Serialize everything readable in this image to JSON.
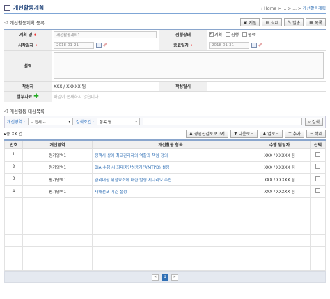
{
  "header": {
    "title": "개선활동계획",
    "breadcrumb": "› Home > ... > ... > ",
    "breadcrumb_current": "개선활동계획"
  },
  "register": {
    "title": "개선활동계획 등록",
    "buttons": [
      "저장",
      "삭제",
      "발송",
      "목록"
    ]
  },
  "form": {
    "plan_name_label": "계획 명",
    "plan_name_value": "개선활동계획1",
    "status_label": "진행상태",
    "status_options": [
      "계획",
      "진행",
      "종료"
    ],
    "start_label": "시작일자",
    "start_value": "2018-01-21",
    "end_label": "종료일자",
    "end_value": "2018-01-31",
    "desc_label": "설명",
    "desc_value": "-",
    "author_label": "작성자",
    "author_value": "XXX / XXXXX 팀",
    "date_label": "작성일시",
    "date_value": "-",
    "attach_label": "첨부자료",
    "attach_value": "파일이 존재하지 않습니다."
  },
  "targets": {
    "title": "개선활동 대상목록",
    "filter1_label": "개선영역 :",
    "filter1_value": "-- 전체 --",
    "filter2_label": "검색조건 :",
    "filter2_value": "항목 명",
    "search_button": "검색",
    "count": "총 XX 건",
    "buttons": [
      "경영진검토보고서",
      "다운로드",
      "업로드",
      "추가",
      "삭제"
    ]
  },
  "table": {
    "headers": [
      "번호",
      "개선영역",
      "개선활동 항목",
      "수행 담당자",
      "선택"
    ],
    "rows": [
      [
        "1",
        "평가영역1",
        "정책서 상에 최고관리자의 역할과 책임 정의",
        "XXX / XXXXX 팀"
      ],
      [
        "2",
        "평가영역1",
        "BIA 수행 시 최대중단허용기간(MTPD) 설정",
        "XXX / XXXXX 팀"
      ],
      [
        "3",
        "평가영역1",
        "관리대상 위험요소에 대한 발생 시나리오 수립",
        "XXX / XXXXX 팀"
      ],
      [
        "4",
        "평가영역1",
        "재해선포 기준 설정",
        "XXX / XXXXX 팀"
      ]
    ]
  },
  "pager": {
    "prev": "«",
    "page": "1",
    "next": "»"
  }
}
